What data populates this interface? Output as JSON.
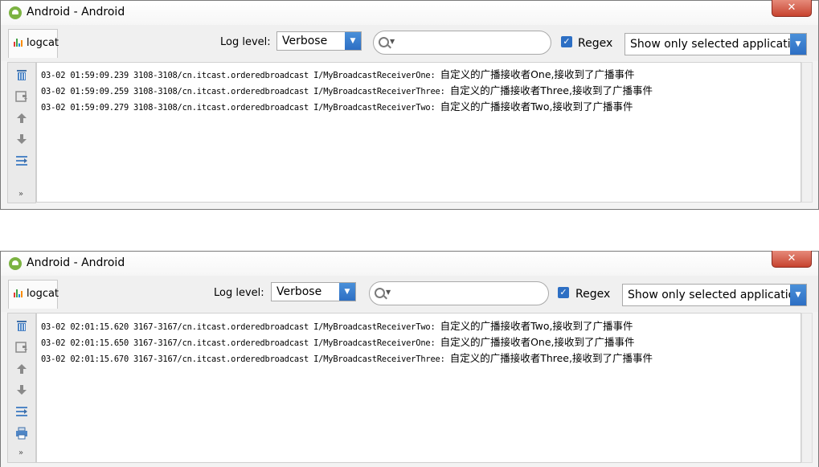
{
  "windows": [
    {
      "title": "Android - Android",
      "close_glyph": "✕",
      "tab_label": "logcat",
      "log_level_label": "Log level:",
      "log_level_value": "Verbose",
      "search_value": "",
      "regex_checked": true,
      "regex_label": "Regex",
      "filter_value": "Show only selected application",
      "sidebar_icons": [
        "trash-icon",
        "save-log-icon",
        "arrow-up-icon",
        "arrow-down-icon",
        "soft-wrap-icon"
      ],
      "more_glyph": "»",
      "log_lines": [
        {
          "meta": "03-02 01:59:09.239 3108-3108/cn.itcast.orderedbroadcast I/MyBroadcastReceiverOne:",
          "message": "自定义的广播接收者One,接收到了广播事件"
        },
        {
          "meta": "03-02 01:59:09.259 3108-3108/cn.itcast.orderedbroadcast I/MyBroadcastReceiverThree:",
          "message": "自定义的广播接收者Three,接收到了广播事件"
        },
        {
          "meta": "03-02 01:59:09.279 3108-3108/cn.itcast.orderedbroadcast I/MyBroadcastReceiverTwo:",
          "message": "自定义的广播接收者Two,接收到了广播事件"
        }
      ]
    },
    {
      "title": "Android - Android",
      "close_glyph": "✕",
      "tab_label": "logcat",
      "log_level_label": "Log level:",
      "log_level_value": "Verbose",
      "search_value": "",
      "regex_checked": true,
      "regex_label": "Regex",
      "filter_value": "Show only selected application",
      "sidebar_icons": [
        "trash-icon",
        "save-log-icon",
        "arrow-up-icon",
        "arrow-down-icon",
        "soft-wrap-icon",
        "print-icon"
      ],
      "more_glyph": "»",
      "log_lines": [
        {
          "meta": "03-02 02:01:15.620 3167-3167/cn.itcast.orderedbroadcast I/MyBroadcastReceiverTwo:",
          "message": "自定义的广播接收者Two,接收到了广播事件"
        },
        {
          "meta": "03-02 02:01:15.650 3167-3167/cn.itcast.orderedbroadcast I/MyBroadcastReceiverOne:",
          "message": "自定义的广播接收者One,接收到了广播事件"
        },
        {
          "meta": "03-02 02:01:15.670 3167-3167/cn.itcast.orderedbroadcast I/MyBroadcastReceiverThree:",
          "message": "自定义的广播接收者Three,接收到了广播事件"
        }
      ]
    }
  ],
  "colors": {
    "accent": "#2d6fc4",
    "close_button": "#c7432f",
    "android_green": "#7cb342"
  }
}
